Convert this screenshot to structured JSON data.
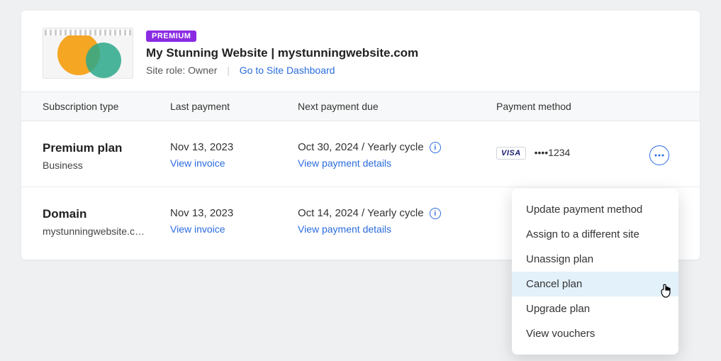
{
  "site": {
    "badge": "PREMIUM",
    "name": "My Stunning Website",
    "domain": "mystunningwebsite.com",
    "role_label": "Site role: Owner",
    "dashboard_link": "Go to Site Dashboard"
  },
  "columns": {
    "type": "Subscription type",
    "last": "Last payment",
    "next": "Next payment due",
    "method": "Payment method"
  },
  "rows": [
    {
      "type_title": "Premium plan",
      "type_sub": "Business",
      "last_date": "Nov 13, 2023",
      "last_link": "View invoice",
      "next_text": "Oct 30, 2024 / Yearly cycle",
      "next_link": "View payment details",
      "method_brand": "VISA",
      "method_last4": "••••1234"
    },
    {
      "type_title": "Domain",
      "type_sub": "mystunningwebsite.c…",
      "last_date": "Nov 13, 2023",
      "last_link": "View invoice",
      "next_text": "Oct 14, 2024 / Yearly cycle",
      "next_link": "View payment details",
      "method_brand": "",
      "method_last4": ""
    }
  ],
  "menu": {
    "update": "Update payment method",
    "assign": "Assign to a different site",
    "unassign": "Unassign plan",
    "cancel": "Cancel plan",
    "upgrade": "Upgrade plan",
    "vouchers": "View vouchers"
  }
}
